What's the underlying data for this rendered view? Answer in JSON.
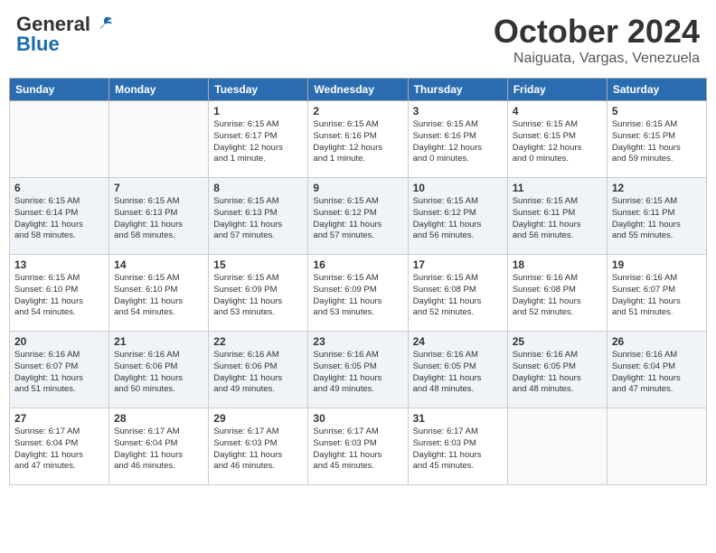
{
  "header": {
    "logo_line1": "General",
    "logo_line2": "Blue",
    "month": "October 2024",
    "location": "Naiguata, Vargas, Venezuela"
  },
  "weekdays": [
    "Sunday",
    "Monday",
    "Tuesday",
    "Wednesday",
    "Thursday",
    "Friday",
    "Saturday"
  ],
  "weeks": [
    [
      {
        "day": "",
        "info": ""
      },
      {
        "day": "",
        "info": ""
      },
      {
        "day": "1",
        "info": "Sunrise: 6:15 AM\nSunset: 6:17 PM\nDaylight: 12 hours\nand 1 minute."
      },
      {
        "day": "2",
        "info": "Sunrise: 6:15 AM\nSunset: 6:16 PM\nDaylight: 12 hours\nand 1 minute."
      },
      {
        "day": "3",
        "info": "Sunrise: 6:15 AM\nSunset: 6:16 PM\nDaylight: 12 hours\nand 0 minutes."
      },
      {
        "day": "4",
        "info": "Sunrise: 6:15 AM\nSunset: 6:15 PM\nDaylight: 12 hours\nand 0 minutes."
      },
      {
        "day": "5",
        "info": "Sunrise: 6:15 AM\nSunset: 6:15 PM\nDaylight: 11 hours\nand 59 minutes."
      }
    ],
    [
      {
        "day": "6",
        "info": "Sunrise: 6:15 AM\nSunset: 6:14 PM\nDaylight: 11 hours\nand 58 minutes."
      },
      {
        "day": "7",
        "info": "Sunrise: 6:15 AM\nSunset: 6:13 PM\nDaylight: 11 hours\nand 58 minutes."
      },
      {
        "day": "8",
        "info": "Sunrise: 6:15 AM\nSunset: 6:13 PM\nDaylight: 11 hours\nand 57 minutes."
      },
      {
        "day": "9",
        "info": "Sunrise: 6:15 AM\nSunset: 6:12 PM\nDaylight: 11 hours\nand 57 minutes."
      },
      {
        "day": "10",
        "info": "Sunrise: 6:15 AM\nSunset: 6:12 PM\nDaylight: 11 hours\nand 56 minutes."
      },
      {
        "day": "11",
        "info": "Sunrise: 6:15 AM\nSunset: 6:11 PM\nDaylight: 11 hours\nand 56 minutes."
      },
      {
        "day": "12",
        "info": "Sunrise: 6:15 AM\nSunset: 6:11 PM\nDaylight: 11 hours\nand 55 minutes."
      }
    ],
    [
      {
        "day": "13",
        "info": "Sunrise: 6:15 AM\nSunset: 6:10 PM\nDaylight: 11 hours\nand 54 minutes."
      },
      {
        "day": "14",
        "info": "Sunrise: 6:15 AM\nSunset: 6:10 PM\nDaylight: 11 hours\nand 54 minutes."
      },
      {
        "day": "15",
        "info": "Sunrise: 6:15 AM\nSunset: 6:09 PM\nDaylight: 11 hours\nand 53 minutes."
      },
      {
        "day": "16",
        "info": "Sunrise: 6:15 AM\nSunset: 6:09 PM\nDaylight: 11 hours\nand 53 minutes."
      },
      {
        "day": "17",
        "info": "Sunrise: 6:15 AM\nSunset: 6:08 PM\nDaylight: 11 hours\nand 52 minutes."
      },
      {
        "day": "18",
        "info": "Sunrise: 6:16 AM\nSunset: 6:08 PM\nDaylight: 11 hours\nand 52 minutes."
      },
      {
        "day": "19",
        "info": "Sunrise: 6:16 AM\nSunset: 6:07 PM\nDaylight: 11 hours\nand 51 minutes."
      }
    ],
    [
      {
        "day": "20",
        "info": "Sunrise: 6:16 AM\nSunset: 6:07 PM\nDaylight: 11 hours\nand 51 minutes."
      },
      {
        "day": "21",
        "info": "Sunrise: 6:16 AM\nSunset: 6:06 PM\nDaylight: 11 hours\nand 50 minutes."
      },
      {
        "day": "22",
        "info": "Sunrise: 6:16 AM\nSunset: 6:06 PM\nDaylight: 11 hours\nand 49 minutes."
      },
      {
        "day": "23",
        "info": "Sunrise: 6:16 AM\nSunset: 6:05 PM\nDaylight: 11 hours\nand 49 minutes."
      },
      {
        "day": "24",
        "info": "Sunrise: 6:16 AM\nSunset: 6:05 PM\nDaylight: 11 hours\nand 48 minutes."
      },
      {
        "day": "25",
        "info": "Sunrise: 6:16 AM\nSunset: 6:05 PM\nDaylight: 11 hours\nand 48 minutes."
      },
      {
        "day": "26",
        "info": "Sunrise: 6:16 AM\nSunset: 6:04 PM\nDaylight: 11 hours\nand 47 minutes."
      }
    ],
    [
      {
        "day": "27",
        "info": "Sunrise: 6:17 AM\nSunset: 6:04 PM\nDaylight: 11 hours\nand 47 minutes."
      },
      {
        "day": "28",
        "info": "Sunrise: 6:17 AM\nSunset: 6:04 PM\nDaylight: 11 hours\nand 46 minutes."
      },
      {
        "day": "29",
        "info": "Sunrise: 6:17 AM\nSunset: 6:03 PM\nDaylight: 11 hours\nand 46 minutes."
      },
      {
        "day": "30",
        "info": "Sunrise: 6:17 AM\nSunset: 6:03 PM\nDaylight: 11 hours\nand 45 minutes."
      },
      {
        "day": "31",
        "info": "Sunrise: 6:17 AM\nSunset: 6:03 PM\nDaylight: 11 hours\nand 45 minutes."
      },
      {
        "day": "",
        "info": ""
      },
      {
        "day": "",
        "info": ""
      }
    ]
  ]
}
